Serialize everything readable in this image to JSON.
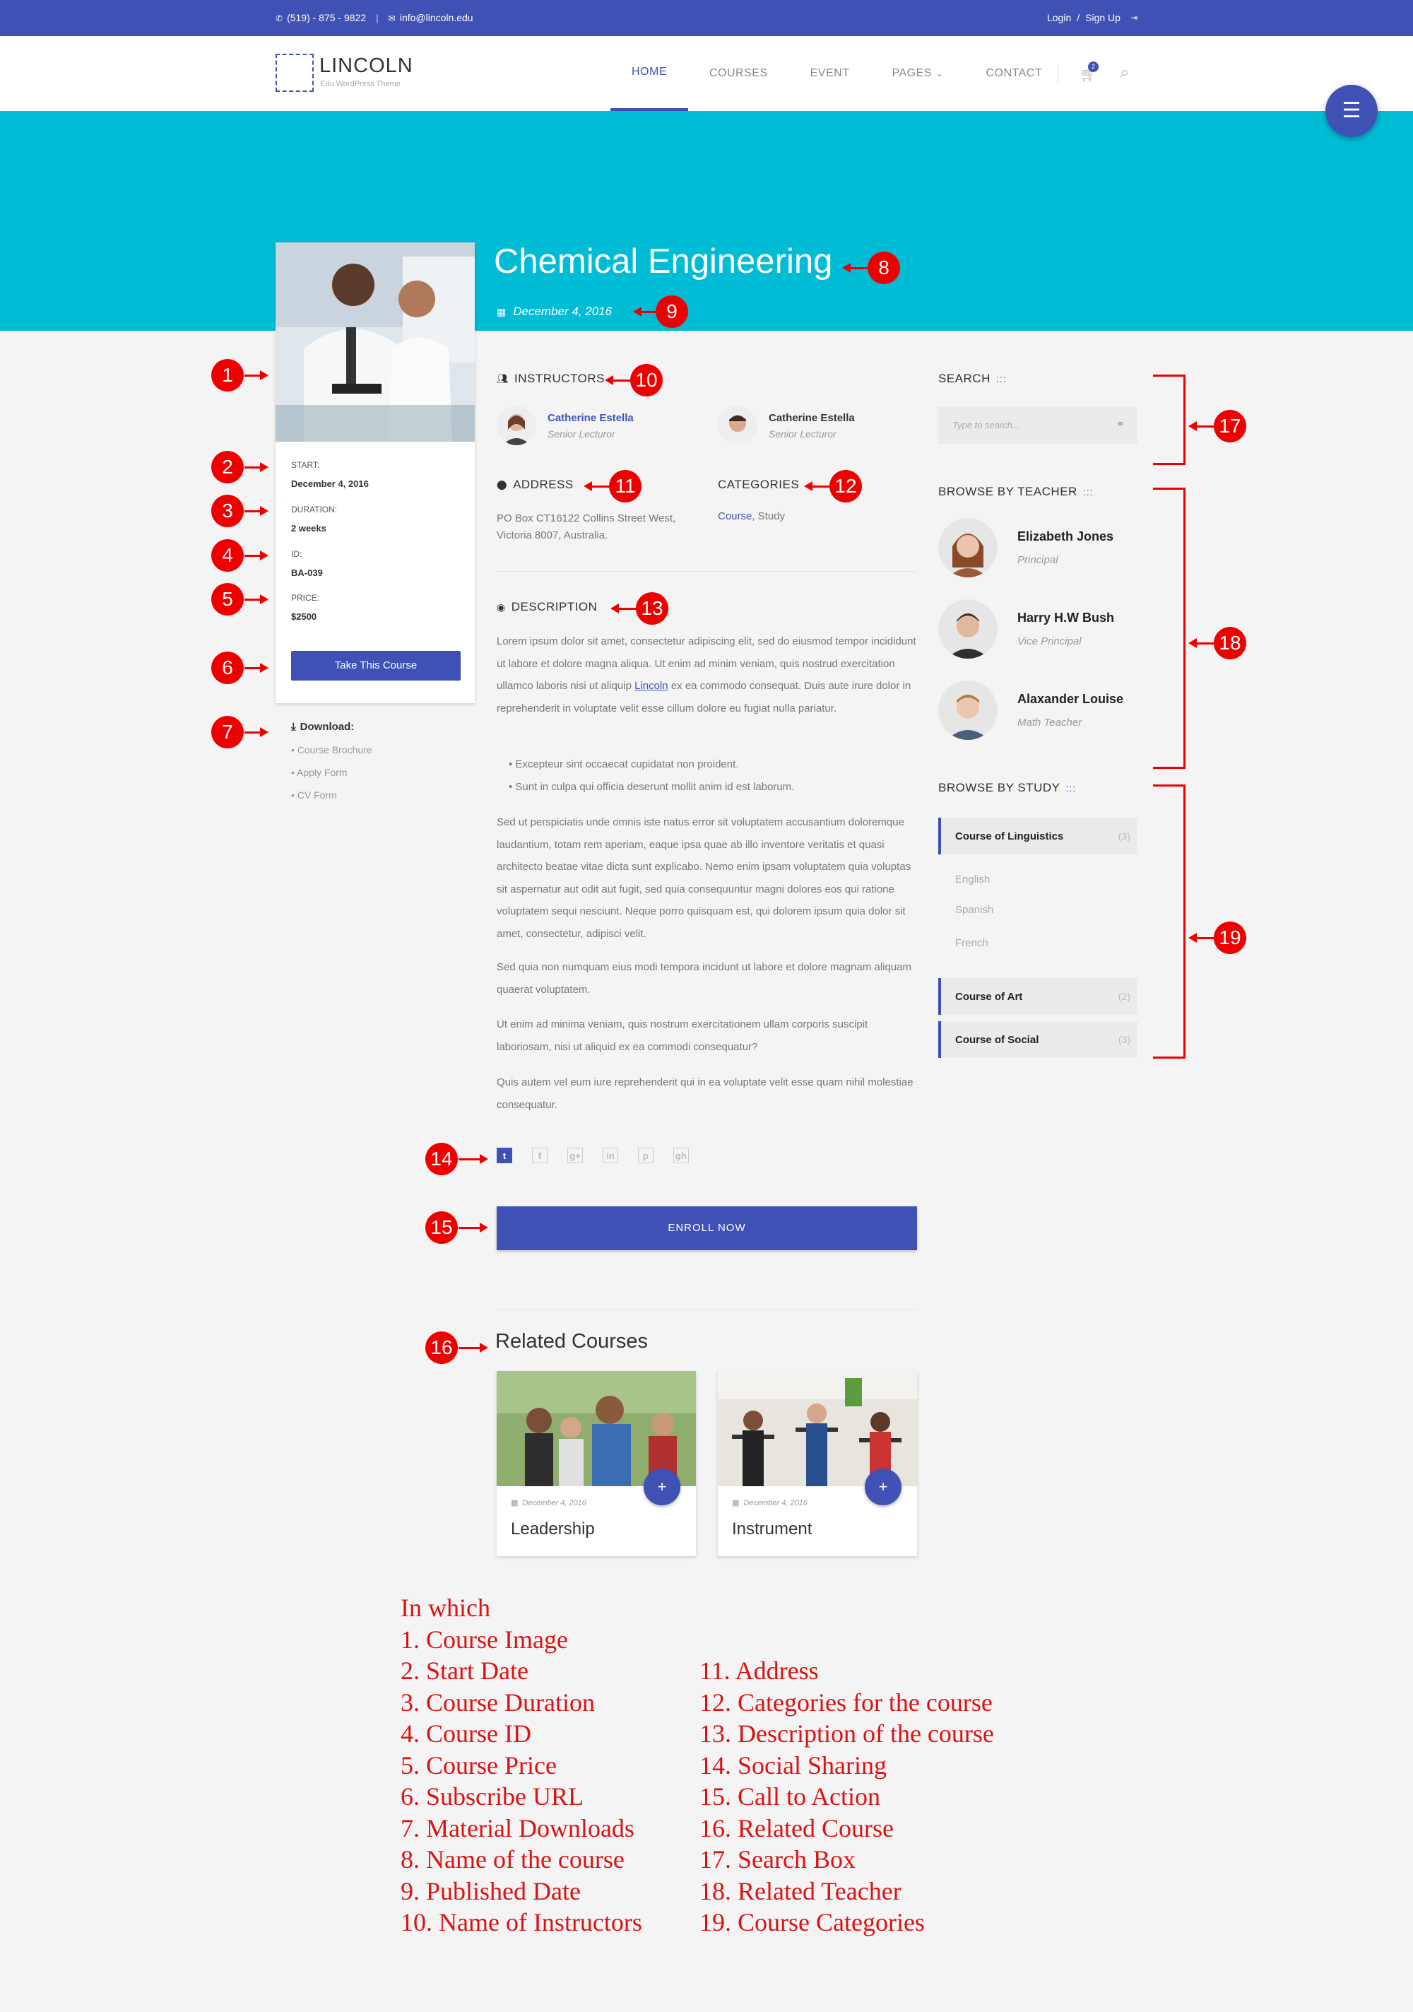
{
  "topbar": {
    "phone": "(519) - 875 - 9822",
    "separator": "|",
    "email": "info@lincoln.edu",
    "login": "Login",
    "slash": "/",
    "signup": "Sign Up"
  },
  "header": {
    "logo_name": "LINCOLN",
    "logo_tagline": "Edu WordPress Theme",
    "nav": [
      "HOME",
      "COURSES",
      "EVENT",
      "PAGES",
      "CONTACT"
    ],
    "pages_caret": "⌄",
    "cart_count": "2",
    "fab_icon": "☰"
  },
  "course": {
    "title": "Chemical Engineering",
    "published": "December 4, 2016",
    "start_label": "START:",
    "start": "December 4, 2016",
    "duration_label": "DURATION:",
    "duration": "2 weeks",
    "id_label": "ID:",
    "id": "BA-039",
    "price_label": "PRICE:",
    "price": "$2500",
    "cta": "Take This Course"
  },
  "downloads": {
    "title": "Download:",
    "items": [
      "• Course Brochure",
      "• Apply Form",
      "• CV Form"
    ]
  },
  "instructors": {
    "heading": "INSTRUCTORS",
    "people": [
      {
        "name": "Catherine Estella",
        "role": "Senior Lecturor"
      },
      {
        "name": "Catherine Estella",
        "role": "Senior Lecturor"
      }
    ]
  },
  "address": {
    "heading": "ADDRESS",
    "line1": "PO Box CT16122 Collins Street West,",
    "line2": "Victoria 8007, Australia."
  },
  "categories": {
    "heading": "CATEGORIES",
    "primary": "Course",
    "rest": ", Study"
  },
  "description": {
    "heading": "DESCRIPTION",
    "p1_before": "Lorem ipsum dolor sit amet, consectetur adipiscing elit, sed do eiusmod tempor incididunt ut labore et dolore magna aliqua. Ut enim ad minim veniam, quis nostrud exercitation ullamco laboris nisi ut aliquip ",
    "p1_link": "Lincoln",
    "p1_after": " ex ea commodo consequat. Duis aute irure dolor in reprehenderit in voluptate velit esse cillum dolore eu fugiat nulla pariatur.",
    "bullets": [
      "• Excepteur sint occaecat cupidatat non proident.",
      "• Sunt in culpa qui officia deserunt mollit anim id est laborum."
    ],
    "p2": "Sed ut perspiciatis unde omnis iste natus error sit voluptatem accusantium doloremque laudantium, totam rem aperiam, eaque ipsa quae ab illo inventore veritatis et quasi architecto beatae vitae dicta sunt explicabo. Nemo enim ipsam voluptatem quia voluptas sit aspernatur aut odit aut fugit, sed quia consequuntur magni dolores eos qui ratione voluptatem sequi nesciunt. Neque porro quisquam est, qui dolorem ipsum quia dolor sit amet, consectetur, adipisci velit.",
    "p3": "Sed quia non numquam eius modi tempora incidunt ut labore et dolore magnam aliquam quaerat voluptatem.",
    "p4": "Ut enim ad minima veniam, quis nostrum exercitationem ullam corporis suscipit laboriosam, nisi ut aliquid ex ea commodi consequatur?",
    "p5": "Quis autem vel eum iure reprehenderit qui in ea voluptate velit esse quam nihil molestiae consequatur."
  },
  "social": [
    "t",
    "f",
    "g+",
    "in",
    "p",
    "gh"
  ],
  "enroll": "ENROLL NOW",
  "related": {
    "title": "Related Courses",
    "items": [
      {
        "date": "December 4, 2016",
        "name": "Leadership"
      },
      {
        "date": "December 4, 2016",
        "name": "Instrument"
      }
    ],
    "plus": "+"
  },
  "sidebar": {
    "search_heading": "SEARCH",
    "search_placeholder": "Type to search...",
    "dots": ":::",
    "teachers_heading": "BROWSE BY TEACHER",
    "teachers": [
      {
        "name": "Elizabeth Jones",
        "role": "Principal"
      },
      {
        "name": "Harry H.W Bush",
        "role": "Vice Principal"
      },
      {
        "name": "Alaxander Louise",
        "role": "Math Teacher"
      }
    ],
    "study_heading": "BROWSE BY STUDY",
    "studies": [
      {
        "name": "Course of Linguistics",
        "count": "(3)"
      },
      {
        "name": "Course of Art",
        "count": "(2)"
      },
      {
        "name": "Course of Social",
        "count": "(3)"
      }
    ],
    "sub_items": [
      "English",
      "Spanish",
      "French"
    ]
  },
  "markers": [
    "1",
    "2",
    "3",
    "4",
    "5",
    "6",
    "7",
    "8",
    "9",
    "10",
    "11",
    "12",
    "13",
    "14",
    "15",
    "16",
    "17",
    "18",
    "19"
  ],
  "legend": {
    "intro": "In which",
    "left": [
      "1. Course Image",
      "2. Start Date",
      "3. Course Duration",
      "4. Course ID",
      "5. Course Price",
      "6. Subscribe URL",
      "7. Material Downloads",
      "8. Name of the course",
      "9.  Published Date",
      "10. Name of Instructors"
    ],
    "right": [
      "11. Address",
      "12. Categories for the course",
      "13. Description of the course",
      "14. Social Sharing",
      "15. Call to Action",
      "16. Related Course",
      "17. Search Box",
      "18. Related Teacher",
      "19. Course Categories"
    ]
  },
  "colors": {
    "primary": "#3f51b5",
    "hero": "#00bcd4",
    "annotation": "#ee0000"
  }
}
